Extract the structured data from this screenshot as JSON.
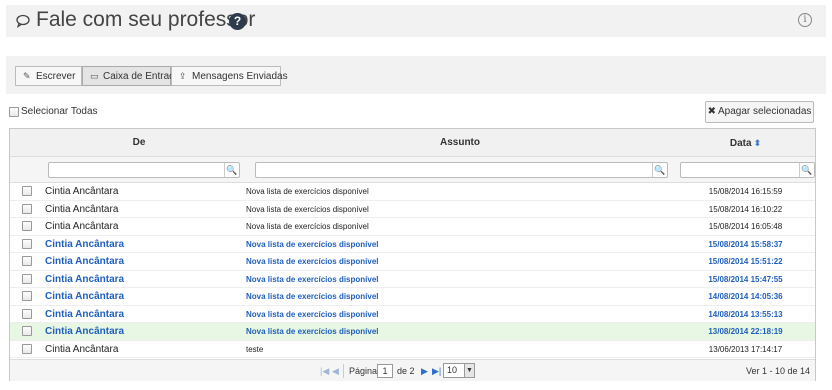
{
  "header": {
    "title": "Fale com seu professor",
    "title_icon": "chat-bubble-icon",
    "help_icon": "question-circle-icon",
    "info_icon": "info-circle-icon"
  },
  "tabs": [
    {
      "label": "Escrever",
      "icon": "pencil-icon",
      "active": false
    },
    {
      "label": "Caixa de Entrada",
      "icon": "inbox-icon",
      "active": true
    },
    {
      "label": "Mensagens Enviadas",
      "icon": "upload-icon",
      "active": false
    }
  ],
  "toolbar": {
    "select_all_label": "Selecionar Todas",
    "delete_label": "Apagar selecionadas"
  },
  "grid": {
    "columns": {
      "from": "De",
      "subject": "Assunto",
      "date": "Data"
    },
    "rows": [
      {
        "from": "Cintia Ancântara",
        "subject": "Nova lista de exercícios disponível",
        "date": "15/08/2014 16:15:59",
        "unread": false,
        "selected": false
      },
      {
        "from": "Cintia Ancântara",
        "subject": "Nova lista de exercícios disponível",
        "date": "15/08/2014 16:10:22",
        "unread": false,
        "selected": false
      },
      {
        "from": "Cintia Ancântara",
        "subject": "Nova lista de exercícios disponível",
        "date": "15/08/2014 16:05:48",
        "unread": false,
        "selected": false
      },
      {
        "from": "Cintia Ancântara",
        "subject": "Nova lista de exercícios disponível",
        "date": "15/08/2014 15:58:37",
        "unread": true,
        "selected": false
      },
      {
        "from": "Cintia Ancântara",
        "subject": "Nova lista de exercícios disponível",
        "date": "15/08/2014 15:51:22",
        "unread": true,
        "selected": false
      },
      {
        "from": "Cintia Ancântara",
        "subject": "Nova lista de exercícios disponível",
        "date": "15/08/2014 15:47:55",
        "unread": true,
        "selected": false
      },
      {
        "from": "Cintia Ancântara",
        "subject": "Nova lista de exercícios disponível",
        "date": "14/08/2014 14:05:36",
        "unread": true,
        "selected": false
      },
      {
        "from": "Cintia Ancântara",
        "subject": "Nova lista de exercícios disponível",
        "date": "14/08/2014 13:55:13",
        "unread": true,
        "selected": false
      },
      {
        "from": "Cintia Ancântara",
        "subject": "Nova lista de exercícios disponível",
        "date": "13/08/2014 22:18:19",
        "unread": true,
        "selected": true
      },
      {
        "from": "Cintia Ancântara",
        "subject": "teste",
        "date": "13/06/2013 17:14:17",
        "unread": false,
        "selected": false
      }
    ]
  },
  "pager": {
    "page_label": "Página",
    "current_page": "1",
    "of_label": "de 2",
    "page_size": "10",
    "info": "Ver 1 - 10 de 14"
  },
  "colors": {
    "unread_text": "#1f5fbd",
    "selected_row": "#e7f7e3",
    "header_bg": "#f2f2f2"
  }
}
